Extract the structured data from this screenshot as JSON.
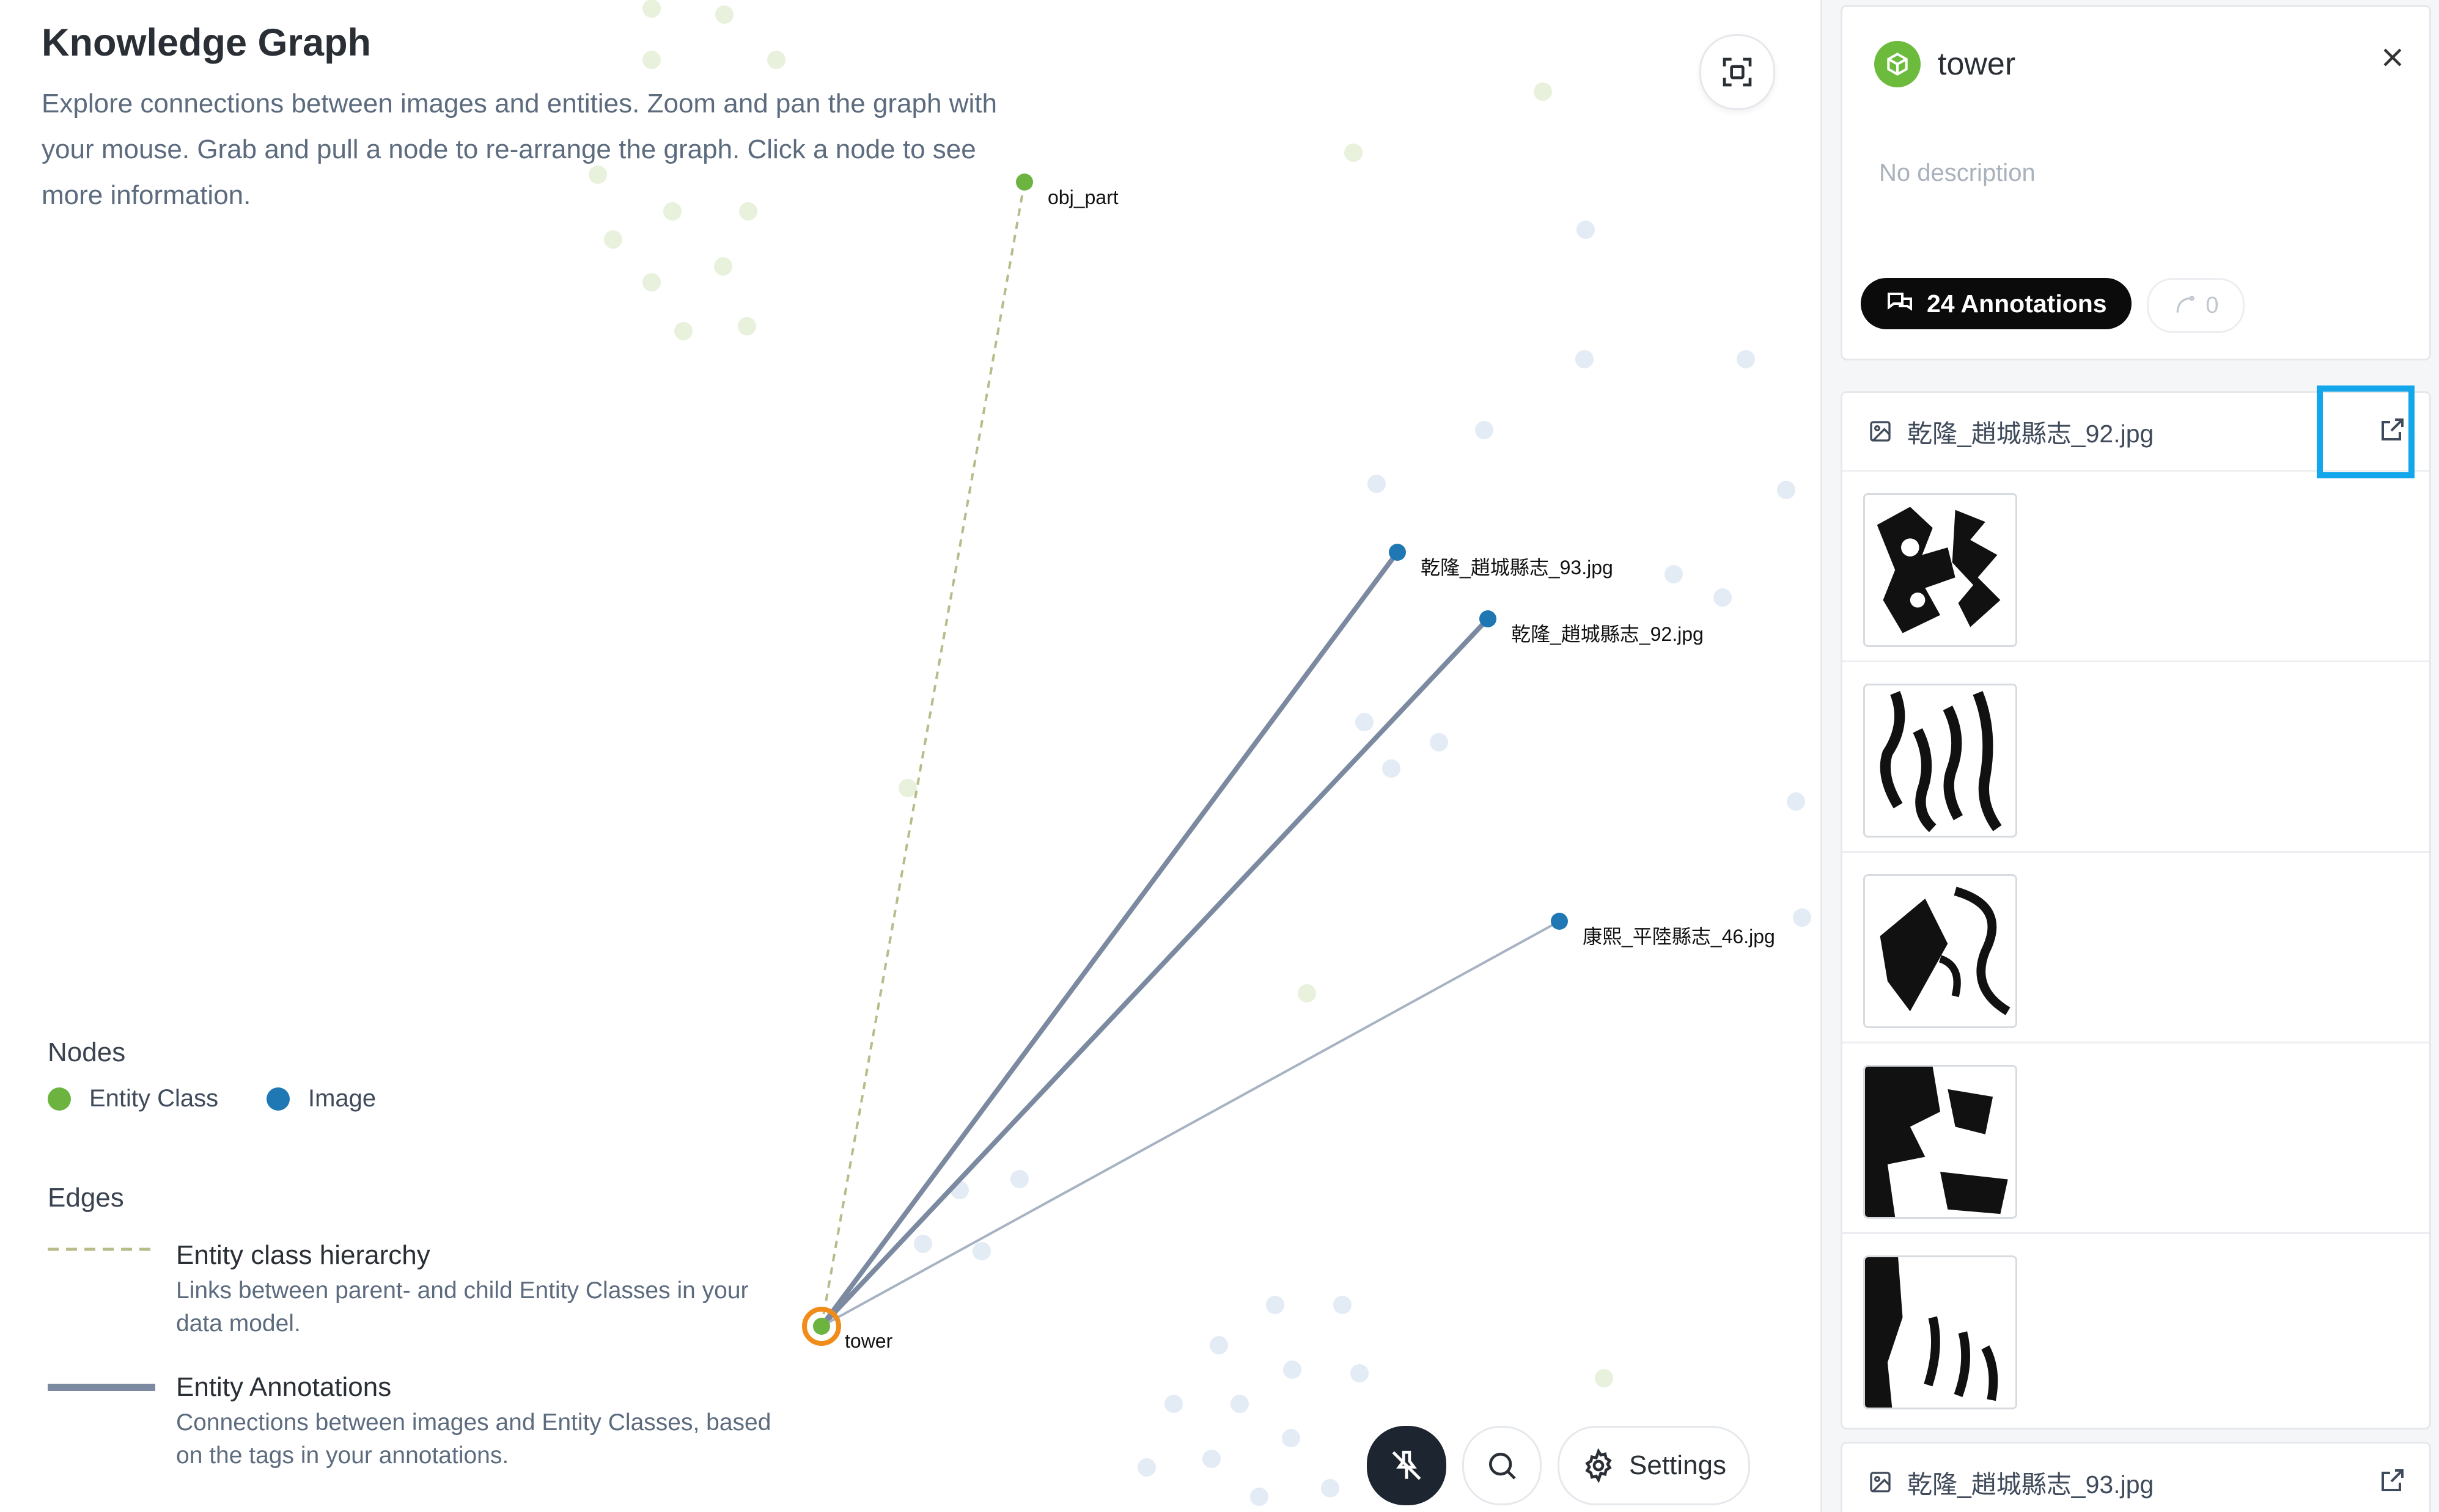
{
  "graph": {
    "title": "Knowledge Graph",
    "description": "Explore connections between images and entities. Zoom and pan the graph with your mouse. Grab and pull a node to re-arrange the graph. Click a node to see more information.",
    "nodes": {
      "obj_part": "obj_part",
      "img93": "乾隆_趙城縣志_93.jpg",
      "img92": "乾隆_趙城縣志_92.jpg",
      "img46": "康熙_平陸縣志_46.jpg",
      "tower": "tower"
    },
    "colors": {
      "entity_class": "#6cb33f",
      "image": "#1f77b4",
      "selected_ring": "#f08c1a",
      "annotation_edge": "#7b8aa0",
      "hierarchy_edge": "#b8bc8a"
    }
  },
  "legend": {
    "nodes_title": "Nodes",
    "entity_class": "Entity Class",
    "image": "Image",
    "edges_title": "Edges",
    "hierarchy_title": "Entity class hierarchy",
    "hierarchy_desc": "Links between parent- and child Entity Classes in your data model.",
    "annotations_title": "Entity Annotations",
    "annotations_desc": "Connections between images and Entity Classes, based on the tags in your annotations."
  },
  "controls": {
    "fit_icon": "fit-to-screen-icon",
    "pin_icon": "unpin-icon",
    "search_icon": "search-icon",
    "settings_label": "Settings"
  },
  "panel": {
    "entity_name": "tower",
    "description": "No description",
    "annotations_label": "24 Annotations",
    "relations_count": "0",
    "files": [
      {
        "name": "乾隆_趙城縣志_92.jpg"
      },
      {
        "name": "乾隆_趙城縣志_93.jpg"
      }
    ]
  }
}
